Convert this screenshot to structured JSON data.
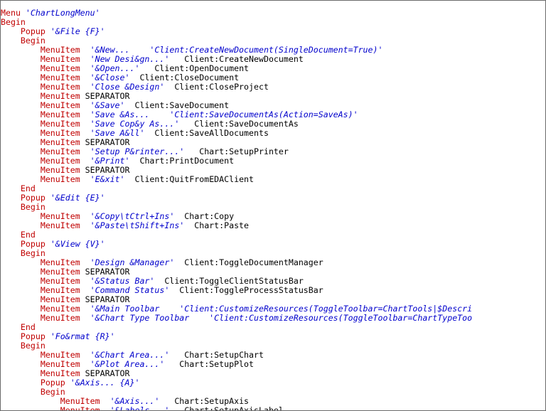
{
  "colors": {
    "keyword": "#c00000",
    "string": "#0000cc",
    "plain": "#000000",
    "background": "#ffffff"
  },
  "lines": [
    [
      {
        "t": "kw",
        "v": "Menu"
      },
      {
        "t": "plain",
        "v": " "
      },
      {
        "t": "str",
        "v": "'ChartLongMenu'"
      }
    ],
    [
      {
        "t": "kw",
        "v": "Begin"
      }
    ],
    [
      {
        "t": "plain",
        "v": "    "
      },
      {
        "t": "kw",
        "v": "Popup"
      },
      {
        "t": "plain",
        "v": " "
      },
      {
        "t": "str",
        "v": "'&File {F}'"
      }
    ],
    [
      {
        "t": "plain",
        "v": "    "
      },
      {
        "t": "kw",
        "v": "Begin"
      }
    ],
    [
      {
        "t": "plain",
        "v": "        "
      },
      {
        "t": "kw",
        "v": "MenuItem"
      },
      {
        "t": "plain",
        "v": "  "
      },
      {
        "t": "str",
        "v": "'&New...    'Client:CreateNewDocument(SingleDocument=True)'"
      }
    ],
    [
      {
        "t": "plain",
        "v": "        "
      },
      {
        "t": "kw",
        "v": "MenuItem"
      },
      {
        "t": "plain",
        "v": "  "
      },
      {
        "t": "str",
        "v": "'New Desi&gn...'"
      },
      {
        "t": "plain",
        "v": "   Client:CreateNewDocument"
      }
    ],
    [
      {
        "t": "plain",
        "v": "        "
      },
      {
        "t": "kw",
        "v": "MenuItem"
      },
      {
        "t": "plain",
        "v": "  "
      },
      {
        "t": "str",
        "v": "'&Open...'"
      },
      {
        "t": "plain",
        "v": "   Client:OpenDocument"
      }
    ],
    [
      {
        "t": "plain",
        "v": "        "
      },
      {
        "t": "kw",
        "v": "MenuItem"
      },
      {
        "t": "plain",
        "v": "  "
      },
      {
        "t": "str",
        "v": "'&Close'"
      },
      {
        "t": "plain",
        "v": "  Client:CloseDocument"
      }
    ],
    [
      {
        "t": "plain",
        "v": "        "
      },
      {
        "t": "kw",
        "v": "MenuItem"
      },
      {
        "t": "plain",
        "v": "  "
      },
      {
        "t": "str",
        "v": "'Close &Design'"
      },
      {
        "t": "plain",
        "v": "  Client:CloseProject"
      }
    ],
    [
      {
        "t": "plain",
        "v": "        "
      },
      {
        "t": "kw",
        "v": "MenuItem"
      },
      {
        "t": "plain",
        "v": " SEPARATOR"
      }
    ],
    [
      {
        "t": "plain",
        "v": "        "
      },
      {
        "t": "kw",
        "v": "MenuItem"
      },
      {
        "t": "plain",
        "v": "  "
      },
      {
        "t": "str",
        "v": "'&Save'"
      },
      {
        "t": "plain",
        "v": "  Client:SaveDocument"
      }
    ],
    [
      {
        "t": "plain",
        "v": "        "
      },
      {
        "t": "kw",
        "v": "MenuItem"
      },
      {
        "t": "plain",
        "v": "  "
      },
      {
        "t": "str",
        "v": "'Save &As...    'Client:SaveDocumentAs(Action=SaveAs)'"
      }
    ],
    [
      {
        "t": "plain",
        "v": "        "
      },
      {
        "t": "kw",
        "v": "MenuItem"
      },
      {
        "t": "plain",
        "v": "  "
      },
      {
        "t": "str",
        "v": "'Save Cop&y As...'"
      },
      {
        "t": "plain",
        "v": "   Client:SaveDocumentAs"
      }
    ],
    [
      {
        "t": "plain",
        "v": "        "
      },
      {
        "t": "kw",
        "v": "MenuItem"
      },
      {
        "t": "plain",
        "v": "  "
      },
      {
        "t": "str",
        "v": "'Save A&ll'"
      },
      {
        "t": "plain",
        "v": "  Client:SaveAllDocuments"
      }
    ],
    [
      {
        "t": "plain",
        "v": "        "
      },
      {
        "t": "kw",
        "v": "MenuItem"
      },
      {
        "t": "plain",
        "v": " SEPARATOR"
      }
    ],
    [
      {
        "t": "plain",
        "v": "        "
      },
      {
        "t": "kw",
        "v": "MenuItem"
      },
      {
        "t": "plain",
        "v": "  "
      },
      {
        "t": "str",
        "v": "'Setup P&rinter...'"
      },
      {
        "t": "plain",
        "v": "   Chart:SetupPrinter"
      }
    ],
    [
      {
        "t": "plain",
        "v": "        "
      },
      {
        "t": "kw",
        "v": "MenuItem"
      },
      {
        "t": "plain",
        "v": "  "
      },
      {
        "t": "str",
        "v": "'&Print'"
      },
      {
        "t": "plain",
        "v": "  Chart:PrintDocument"
      }
    ],
    [
      {
        "t": "plain",
        "v": "        "
      },
      {
        "t": "kw",
        "v": "MenuItem"
      },
      {
        "t": "plain",
        "v": " SEPARATOR"
      }
    ],
    [
      {
        "t": "plain",
        "v": "        "
      },
      {
        "t": "kw",
        "v": "MenuItem"
      },
      {
        "t": "plain",
        "v": "  "
      },
      {
        "t": "str",
        "v": "'E&xit'"
      },
      {
        "t": "plain",
        "v": "  Client:QuitFromEDAClient"
      }
    ],
    [
      {
        "t": "plain",
        "v": "    "
      },
      {
        "t": "kw",
        "v": "End"
      }
    ],
    [
      {
        "t": "plain",
        "v": "    "
      },
      {
        "t": "kw",
        "v": "Popup"
      },
      {
        "t": "plain",
        "v": " "
      },
      {
        "t": "str",
        "v": "'&Edit {E}'"
      }
    ],
    [
      {
        "t": "plain",
        "v": "    "
      },
      {
        "t": "kw",
        "v": "Begin"
      }
    ],
    [
      {
        "t": "plain",
        "v": "        "
      },
      {
        "t": "kw",
        "v": "MenuItem"
      },
      {
        "t": "plain",
        "v": "  "
      },
      {
        "t": "str",
        "v": "'&Copy\\tCtrl+Ins'"
      },
      {
        "t": "plain",
        "v": "  Chart:Copy"
      }
    ],
    [
      {
        "t": "plain",
        "v": "        "
      },
      {
        "t": "kw",
        "v": "MenuItem"
      },
      {
        "t": "plain",
        "v": "  "
      },
      {
        "t": "str",
        "v": "'&Paste\\tShift+Ins'"
      },
      {
        "t": "plain",
        "v": "  Chart:Paste"
      }
    ],
    [
      {
        "t": "plain",
        "v": "    "
      },
      {
        "t": "kw",
        "v": "End"
      }
    ],
    [
      {
        "t": "plain",
        "v": "    "
      },
      {
        "t": "kw",
        "v": "Popup"
      },
      {
        "t": "plain",
        "v": " "
      },
      {
        "t": "str",
        "v": "'&View {V}'"
      }
    ],
    [
      {
        "t": "plain",
        "v": "    "
      },
      {
        "t": "kw",
        "v": "Begin"
      }
    ],
    [
      {
        "t": "plain",
        "v": "        "
      },
      {
        "t": "kw",
        "v": "MenuItem"
      },
      {
        "t": "plain",
        "v": "  "
      },
      {
        "t": "str",
        "v": "'Design &Manager'"
      },
      {
        "t": "plain",
        "v": "  Client:ToggleDocumentManager"
      }
    ],
    [
      {
        "t": "plain",
        "v": "        "
      },
      {
        "t": "kw",
        "v": "MenuItem"
      },
      {
        "t": "plain",
        "v": " SEPARATOR"
      }
    ],
    [
      {
        "t": "plain",
        "v": "        "
      },
      {
        "t": "kw",
        "v": "MenuItem"
      },
      {
        "t": "plain",
        "v": "  "
      },
      {
        "t": "str",
        "v": "'&Status Bar'"
      },
      {
        "t": "plain",
        "v": "  Client:ToggleClientStatusBar"
      }
    ],
    [
      {
        "t": "plain",
        "v": "        "
      },
      {
        "t": "kw",
        "v": "MenuItem"
      },
      {
        "t": "plain",
        "v": "  "
      },
      {
        "t": "str",
        "v": "'Command Status'"
      },
      {
        "t": "plain",
        "v": "  Client:ToggleProcessStatusBar"
      }
    ],
    [
      {
        "t": "plain",
        "v": "        "
      },
      {
        "t": "kw",
        "v": "MenuItem"
      },
      {
        "t": "plain",
        "v": " SEPARATOR"
      }
    ],
    [
      {
        "t": "plain",
        "v": "        "
      },
      {
        "t": "kw",
        "v": "MenuItem"
      },
      {
        "t": "plain",
        "v": "  "
      },
      {
        "t": "str",
        "v": "'&Main Toolbar    'Client:CustomizeResources(ToggleToolbar=ChartTools|$Descri"
      }
    ],
    [
      {
        "t": "plain",
        "v": "        "
      },
      {
        "t": "kw",
        "v": "MenuItem"
      },
      {
        "t": "plain",
        "v": "  "
      },
      {
        "t": "str",
        "v": "'&Chart Type Toolbar    'Client:CustomizeResources(ToggleToolbar=ChartTypeToo"
      }
    ],
    [
      {
        "t": "plain",
        "v": "    "
      },
      {
        "t": "kw",
        "v": "End"
      }
    ],
    [
      {
        "t": "plain",
        "v": "    "
      },
      {
        "t": "kw",
        "v": "Popup"
      },
      {
        "t": "plain",
        "v": " "
      },
      {
        "t": "str",
        "v": "'Fo&rmat {R}'"
      }
    ],
    [
      {
        "t": "plain",
        "v": "    "
      },
      {
        "t": "kw",
        "v": "Begin"
      }
    ],
    [
      {
        "t": "plain",
        "v": "        "
      },
      {
        "t": "kw",
        "v": "MenuItem"
      },
      {
        "t": "plain",
        "v": "  "
      },
      {
        "t": "str",
        "v": "'&Chart Area...'"
      },
      {
        "t": "plain",
        "v": "   Chart:SetupChart"
      }
    ],
    [
      {
        "t": "plain",
        "v": "        "
      },
      {
        "t": "kw",
        "v": "MenuItem"
      },
      {
        "t": "plain",
        "v": "  "
      },
      {
        "t": "str",
        "v": "'&Plot Area...'"
      },
      {
        "t": "plain",
        "v": "   Chart:SetupPlot"
      }
    ],
    [
      {
        "t": "plain",
        "v": "        "
      },
      {
        "t": "kw",
        "v": "MenuItem"
      },
      {
        "t": "plain",
        "v": " SEPARATOR"
      }
    ],
    [
      {
        "t": "plain",
        "v": "        "
      },
      {
        "t": "kw",
        "v": "Popup"
      },
      {
        "t": "plain",
        "v": " "
      },
      {
        "t": "str",
        "v": "'&Axis... {A}'"
      }
    ],
    [
      {
        "t": "plain",
        "v": "        "
      },
      {
        "t": "kw",
        "v": "Begin"
      }
    ],
    [
      {
        "t": "plain",
        "v": "            "
      },
      {
        "t": "kw",
        "v": "MenuItem"
      },
      {
        "t": "plain",
        "v": "  "
      },
      {
        "t": "str",
        "v": "'&Axis...'"
      },
      {
        "t": "plain",
        "v": "   Chart:SetupAxis"
      }
    ],
    [
      {
        "t": "plain",
        "v": "            "
      },
      {
        "t": "kw",
        "v": "MenuItem"
      },
      {
        "t": "plain",
        "v": "  "
      },
      {
        "t": "str",
        "v": "'&Labels...'"
      },
      {
        "t": "plain",
        "v": "   Chart:SetupAxisLabel"
      }
    ]
  ]
}
